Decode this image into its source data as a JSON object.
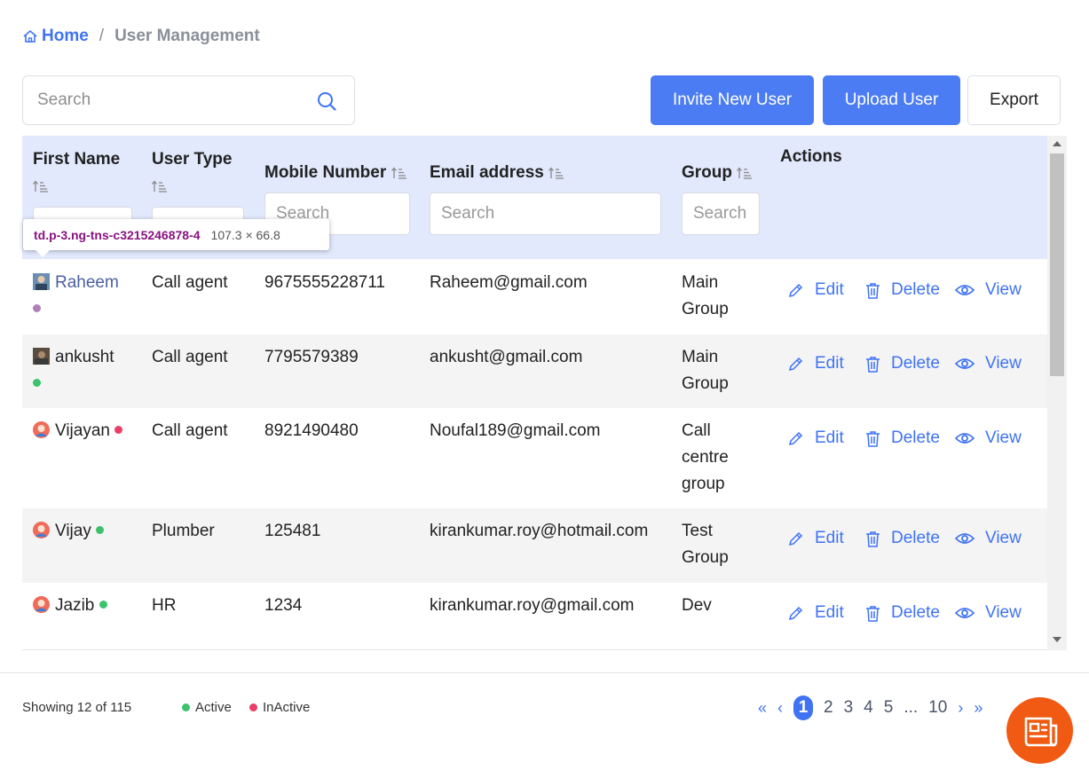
{
  "breadcrumb": {
    "home": "Home",
    "separator": "/",
    "current": "User Management"
  },
  "search": {
    "placeholder": "Search"
  },
  "toolbar": {
    "invite_label": "Invite New User",
    "upload_label": "Upload User",
    "export_label": "Export"
  },
  "table": {
    "headers": {
      "first_name": "First Name",
      "user_type": "User Type",
      "mobile": "Mobile Number",
      "email": "Email address",
      "group": "Group",
      "actions": "Actions"
    },
    "filters": {
      "mobile_placeholder": "Search",
      "email_placeholder": "Search",
      "group_placeholder": "Search"
    },
    "rows": [
      {
        "name": "Raheem",
        "user_type": "Call agent",
        "mobile": "9675555228711",
        "email": "Raheem@gmail.com",
        "group_line1": "Main",
        "group_line2": "Group",
        "group_line3": "",
        "status": "inactive"
      },
      {
        "name": "ankusht",
        "user_type": "Call agent",
        "mobile": "7795579389",
        "email": "ankusht@gmail.com",
        "group_line1": "Main",
        "group_line2": "Group",
        "group_line3": "",
        "status": "active"
      },
      {
        "name": "Vijayan",
        "user_type": "Call agent",
        "mobile": "8921490480",
        "email": "Noufal189@gmail.com",
        "group_line1": "Call",
        "group_line2": "centre",
        "group_line3": "group",
        "status": "inactive"
      },
      {
        "name": "Vijay",
        "user_type": "Plumber",
        "mobile": "125481",
        "email": "kirankumar.roy@hotmail.com",
        "group_line1": "Test",
        "group_line2": "Group",
        "group_line3": "",
        "status": "active"
      },
      {
        "name": "Jazib",
        "user_type": "HR",
        "mobile": "1234",
        "email": "kirankumar.roy@gmail.com",
        "group_line1": "Dev",
        "group_line2": "",
        "group_line3": "",
        "status": "active"
      }
    ],
    "actions": {
      "edit": "Edit",
      "delete": "Delete",
      "view": "View"
    }
  },
  "devtools_tooltip": {
    "selector": "td.p-3.ng-tns-c3215246878-4",
    "dimensions": "107.3 × 66.8"
  },
  "footer": {
    "showing": "Showing 12 of 115",
    "legend_active": "Active",
    "legend_inactive": "InActive",
    "pagination": {
      "first": "«",
      "prev": "‹",
      "pages": [
        "1",
        "2",
        "3",
        "4",
        "5"
      ],
      "ellipsis": "...",
      "last_page": "10",
      "next": "›",
      "last": "»",
      "current": "1"
    }
  },
  "colors": {
    "accent": "#4b7cf3",
    "active": "#3ec16d",
    "inactive": "#ea3d67",
    "fab": "#f05a12",
    "header_bg": "#e2e9fd"
  }
}
